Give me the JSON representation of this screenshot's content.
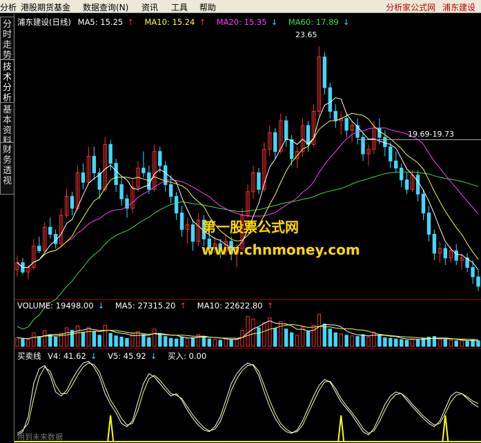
{
  "menu": {
    "items": [
      "分析",
      "港股期货基金",
      "数据查询(N)",
      "资讯",
      "工具",
      "帮助"
    ],
    "right_labels": [
      "分析家公式网",
      "浦东建设"
    ]
  },
  "side_tabs": [
    "分时走势",
    "技术分析",
    "基本资料",
    "财务透视"
  ],
  "main_panel": {
    "stock_label": "浦东建设(日线)",
    "ma": [
      {
        "label": "MA5: 15.25",
        "arrow": "↑",
        "color": "#ffffff"
      },
      {
        "label": "MA10: 15.24",
        "arrow": "↑",
        "color": "#ffff40"
      },
      {
        "label": "MA20: 15.35",
        "arrow": "↓",
        "color": "#ff40ff"
      },
      {
        "label": "MA60: 17.89",
        "arrow": "↓",
        "color": "#40e040"
      }
    ],
    "high_label": "23.65",
    "range_label": "19.69-19.73"
  },
  "volume_panel": {
    "items": [
      {
        "label": "VOLUME: 19498.00",
        "arrow": "↓"
      },
      {
        "label": "MA5: 27315.20",
        "arrow": "↑"
      },
      {
        "label": "MA10: 22622.80",
        "arrow": "↑"
      }
    ]
  },
  "indicator_panel": {
    "name": "买卖线",
    "items": [
      {
        "label": "V4: 41.62",
        "arrow": "↓"
      },
      {
        "label": "V5: 45.92",
        "arrow": "↓"
      },
      {
        "label": "买入: 0.00",
        "arrow": ""
      }
    ],
    "footer": "用到未来数据"
  },
  "watermark": {
    "line1": "第一股票公式网",
    "line2": "www.chnmoney.com"
  },
  "colors": {
    "up": "#ff3030",
    "down": "#40d8ff",
    "ma5": "#ffffff",
    "ma10": "#ffff40",
    "ma20": "#ff40ff",
    "ma60": "#40e040",
    "panel_border": "#b00000",
    "watermark": "#ffd800"
  },
  "chart_data": {
    "type": "candlestick",
    "price_range": [
      13.0,
      24.5
    ],
    "candles": [
      [
        14.2,
        14.8,
        13.9,
        14.5
      ],
      [
        14.5,
        14.7,
        14.0,
        14.1
      ],
      [
        14.1,
        14.4,
        13.8,
        14.3
      ],
      [
        14.3,
        15.5,
        14.2,
        15.2
      ],
      [
        15.2,
        15.6,
        14.9,
        15.0
      ],
      [
        15.0,
        16.2,
        14.9,
        16.0
      ],
      [
        16.0,
        16.4,
        15.5,
        15.7
      ],
      [
        15.7,
        15.9,
        15.1,
        15.3
      ],
      [
        15.3,
        16.8,
        15.2,
        16.5
      ],
      [
        16.5,
        17.6,
        16.4,
        17.3
      ],
      [
        17.3,
        17.5,
        16.5,
        16.8
      ],
      [
        16.8,
        18.6,
        16.7,
        18.3
      ],
      [
        18.3,
        18.7,
        17.6,
        17.9
      ],
      [
        17.9,
        19.4,
        17.8,
        19.0
      ],
      [
        19.0,
        19.4,
        18.0,
        18.3
      ],
      [
        18.3,
        18.5,
        17.2,
        17.6
      ],
      [
        17.6,
        19.8,
        17.5,
        19.5
      ],
      [
        19.5,
        19.7,
        18.4,
        18.7
      ],
      [
        18.7,
        18.9,
        17.5,
        17.8
      ],
      [
        17.8,
        18.1,
        16.9,
        17.2
      ],
      [
        17.2,
        17.4,
        16.4,
        16.8
      ],
      [
        16.8,
        18.0,
        16.6,
        17.7
      ],
      [
        17.7,
        18.8,
        17.5,
        18.5
      ],
      [
        18.5,
        19.2,
        18.1,
        18.3
      ],
      [
        18.3,
        18.6,
        17.4,
        17.6
      ],
      [
        17.6,
        19.5,
        17.5,
        19.2
      ],
      [
        19.2,
        19.4,
        18.3,
        18.6
      ],
      [
        18.6,
        18.8,
        17.5,
        17.8
      ],
      [
        17.8,
        18.2,
        17.0,
        17.3
      ],
      [
        17.3,
        17.5,
        16.3,
        16.6
      ],
      [
        16.6,
        16.9,
        15.6,
        15.9
      ],
      [
        15.9,
        16.4,
        15.3,
        16.1
      ],
      [
        16.1,
        16.3,
        15.0,
        15.4
      ],
      [
        15.4,
        16.6,
        15.2,
        16.3
      ],
      [
        16.3,
        16.5,
        15.2,
        15.5
      ],
      [
        15.5,
        15.8,
        14.8,
        15.1
      ],
      [
        15.1,
        15.6,
        14.9,
        15.3
      ],
      [
        15.3,
        15.5,
        14.7,
        15.0
      ],
      [
        15.0,
        15.7,
        14.8,
        15.4
      ],
      [
        15.4,
        15.6,
        14.6,
        14.9
      ],
      [
        14.9,
        15.3,
        14.3,
        15.1
      ],
      [
        15.1,
        16.8,
        15.0,
        16.5
      ],
      [
        16.5,
        17.8,
        16.4,
        17.5
      ],
      [
        17.5,
        18.6,
        17.2,
        18.3
      ],
      [
        18.3,
        18.5,
        17.4,
        17.6
      ],
      [
        17.6,
        19.6,
        17.5,
        19.3
      ],
      [
        19.3,
        20.3,
        19.0,
        20.0
      ],
      [
        20.0,
        20.2,
        18.9,
        19.2
      ],
      [
        19.2,
        20.8,
        19.1,
        20.5
      ],
      [
        20.5,
        20.7,
        19.4,
        19.7
      ],
      [
        19.7,
        19.9,
        18.6,
        18.9
      ],
      [
        18.9,
        19.4,
        18.5,
        19.2
      ],
      [
        19.2,
        20.6,
        19.0,
        20.3
      ],
      [
        20.3,
        20.5,
        19.2,
        19.5
      ],
      [
        19.5,
        21.2,
        19.4,
        20.9
      ],
      [
        20.9,
        23.65,
        20.7,
        23.2
      ],
      [
        23.2,
        23.4,
        21.6,
        21.9
      ],
      [
        21.9,
        22.1,
        20.6,
        20.9
      ],
      [
        20.9,
        21.2,
        20.2,
        20.5
      ],
      [
        20.5,
        20.9,
        19.9,
        20.6
      ],
      [
        20.6,
        20.8,
        19.8,
        20.1
      ],
      [
        20.1,
        20.5,
        19.6,
        20.3
      ],
      [
        20.3,
        20.6,
        19.5,
        19.8
      ],
      [
        19.8,
        20.0,
        18.8,
        19.1
      ],
      [
        19.1,
        19.5,
        18.6,
        19.3
      ],
      [
        19.3,
        20.5,
        19.1,
        20.2
      ],
      [
        20.2,
        20.6,
        19.5,
        19.8
      ],
      [
        19.8,
        20.1,
        19.0,
        19.4
      ],
      [
        19.4,
        19.6,
        18.5,
        18.8
      ],
      [
        18.8,
        19.2,
        18.3,
        18.5
      ],
      [
        18.5,
        18.7,
        17.7,
        18.0
      ],
      [
        18.0,
        18.3,
        17.4,
        17.6
      ],
      [
        17.6,
        18.4,
        17.5,
        18.2
      ],
      [
        18.2,
        18.4,
        17.1,
        17.4
      ],
      [
        17.4,
        17.6,
        16.3,
        16.6
      ],
      [
        16.6,
        16.9,
        15.4,
        15.7
      ],
      [
        15.7,
        15.9,
        14.6,
        14.9
      ],
      [
        14.9,
        15.4,
        14.5,
        15.1
      ],
      [
        15.1,
        15.3,
        14.4,
        14.7
      ],
      [
        14.7,
        15.2,
        14.5,
        15.0
      ],
      [
        15.0,
        15.3,
        14.4,
        14.6
      ],
      [
        14.6,
        14.9,
        14.2,
        14.7
      ],
      [
        14.7,
        14.9,
        14.1,
        14.3
      ],
      [
        14.3,
        14.6,
        13.6,
        13.9
      ],
      [
        13.9,
        14.2,
        13.3,
        13.5
      ]
    ],
    "volume_range": [
      0,
      60000
    ],
    "volumes": [
      14000,
      12000,
      11000,
      22000,
      16000,
      25000,
      19000,
      15000,
      21000,
      30000,
      26000,
      33000,
      22000,
      31000,
      24000,
      18000,
      34000,
      21000,
      17000,
      15000,
      13000,
      20000,
      24000,
      19000,
      14000,
      28000,
      20000,
      16000,
      13000,
      12000,
      15000,
      13000,
      14000,
      19000,
      16000,
      12000,
      11000,
      10000,
      12000,
      11000,
      12000,
      26000,
      48000,
      44000,
      30000,
      38000,
      46000,
      29000,
      40000,
      28000,
      22000,
      18000,
      31000,
      24000,
      34000,
      52000,
      36000,
      28000,
      22000,
      20000,
      18000,
      17000,
      16000,
      19000,
      15000,
      23000,
      18000,
      14000,
      13000,
      12000,
      11000,
      10000,
      12000,
      11000,
      13000,
      15000,
      16000,
      12000,
      11000,
      10000,
      9000,
      9000,
      8000,
      10000,
      9000
    ],
    "indicator_range": [
      0,
      100
    ],
    "v4": [
      8,
      12,
      30,
      70,
      88,
      92,
      80,
      60,
      55,
      62,
      75,
      86,
      95,
      97,
      90,
      78,
      58,
      45,
      35,
      22,
      18,
      25,
      48,
      70,
      82,
      78,
      70,
      62,
      55,
      58,
      50,
      38,
      28,
      20,
      14,
      12,
      18,
      30,
      50,
      70,
      82,
      90,
      95,
      92,
      80,
      60,
      42,
      28,
      18,
      12,
      10,
      14,
      25,
      40,
      55,
      68,
      75,
      72,
      60,
      48,
      40,
      32,
      22,
      12,
      8,
      16,
      30,
      45,
      55,
      60,
      58,
      50,
      42,
      35,
      28,
      22,
      18,
      25,
      40,
      55,
      60,
      58,
      52,
      46,
      41.62
    ],
    "v5": [
      10,
      14,
      22,
      52,
      78,
      90,
      85,
      68,
      58,
      58,
      68,
      80,
      90,
      95,
      93,
      84,
      66,
      50,
      40,
      28,
      20,
      22,
      38,
      60,
      76,
      80,
      74,
      66,
      58,
      56,
      52,
      42,
      32,
      24,
      17,
      13,
      15,
      24,
      42,
      62,
      76,
      86,
      92,
      93,
      85,
      68,
      50,
      34,
      22,
      15,
      11,
      12,
      20,
      34,
      48,
      62,
      72,
      73,
      64,
      52,
      43,
      35,
      26,
      16,
      10,
      13,
      24,
      38,
      50,
      57,
      58,
      53,
      45,
      38,
      31,
      25,
      20,
      22,
      34,
      48,
      56,
      58,
      54,
      49,
      45.92
    ],
    "buy_signals": [
      17,
      59,
      78
    ]
  }
}
